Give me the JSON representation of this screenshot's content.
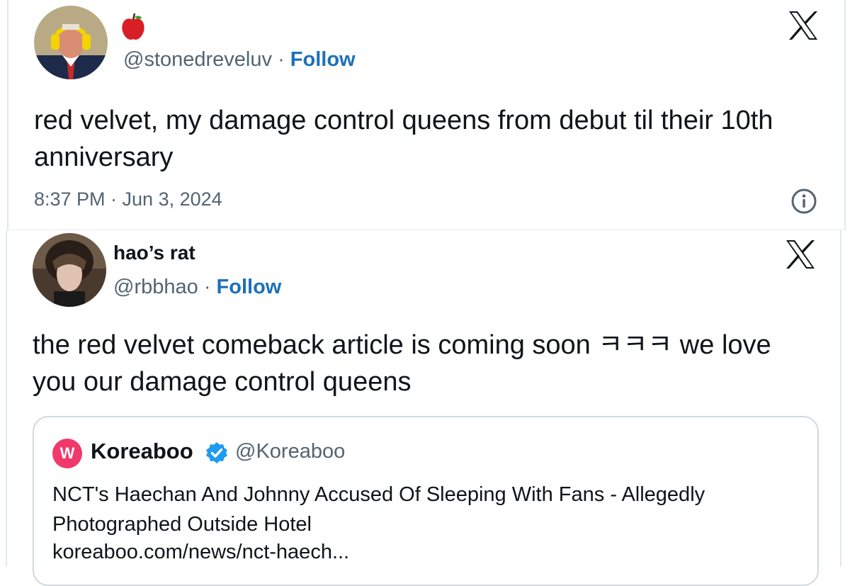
{
  "tweet1": {
    "name_emoji": "🍎",
    "handle": "@stonedreveluv",
    "separator": "·",
    "follow_label": "Follow",
    "body": "red velvet, my damage control queens from debut til their 10th anniversary",
    "timestamp": "8:37 PM · Jun 3, 2024"
  },
  "tweet2": {
    "name": "hao’s rat",
    "handle": "@rbbhao",
    "separator": "·",
    "follow_label": "Follow",
    "body": "the red velvet comeback article is coming soon ㅋㅋㅋ we love you our damage control queens",
    "quote": {
      "avatar_letter": "W",
      "name": "Koreaboo",
      "handle": "@Koreaboo",
      "text": "NCT's Haechan And Johnny Accused Of Sleeping With Fans - Allegedly Photographed Outside Hotel",
      "link": "koreaboo.com/news/nct-haech..."
    }
  },
  "icons": {
    "x_logo": "x-logo-icon",
    "info": "info-icon",
    "verified": "verified-badge-icon",
    "name_emoji": "apple-emoji-icon"
  },
  "colors": {
    "follow": "#1d70b8",
    "secondary_text": "#536471",
    "verified": "#1d9bf0",
    "koreaboo_brand": "#f0386b",
    "border": "#cfd9de"
  }
}
